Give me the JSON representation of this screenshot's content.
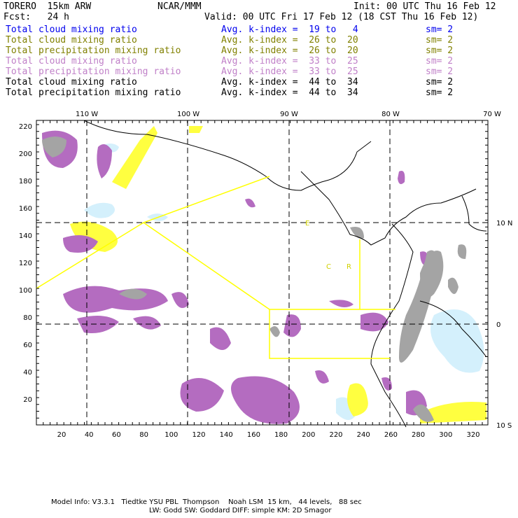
{
  "header": {
    "model": "TORERO  15km ARW",
    "org": "NCAR/MMM",
    "init": "Init: 00 UTC Thu 16 Feb 12",
    "fcst": "Fcst:   24 h",
    "valid": "Valid: 00 UTC Fri 17 Feb 12 (18 CST Thu 16 Feb 12)"
  },
  "legend": [
    {
      "field": "Total cloud mixing ratio",
      "kindex": "Avg. k-index =  19 to   4",
      "sm": "sm= 2",
      "color": "#0000ee"
    },
    {
      "field": "Total cloud mixing ratio",
      "kindex": "Avg. k-index =  26 to  20",
      "sm": "sm= 2",
      "color": "#808000"
    },
    {
      "field": "Total precipitation mixing ratio",
      "kindex": "Avg. k-index =  26 to  20",
      "sm": "sm= 2",
      "color": "#808000"
    },
    {
      "field": "Total cloud mixing ratio",
      "kindex": "Avg. k-index =  33 to  25",
      "sm": "sm= 2",
      "color": "#c080c8"
    },
    {
      "field": "Total precipitation mixing ratio",
      "kindex": "Avg. k-index =  33 to  25",
      "sm": "sm= 2",
      "color": "#c080c8"
    },
    {
      "field": "Total cloud mixing ratio",
      "kindex": "Avg. k-index =  44 to  34",
      "sm": "sm= 2",
      "color": "#000000"
    },
    {
      "field": "Total precipitation mixing ratio",
      "kindex": "Avg. k-index =  44 to  34",
      "sm": "sm= 2",
      "color": "#000000"
    }
  ],
  "map": {
    "top_lon_labels": [
      "110 W",
      "100 W",
      "90 W",
      "80 W",
      "70 W"
    ],
    "right_lat_labels": [
      "10 N",
      "0",
      "10 S"
    ],
    "y_ticks": [
      "220",
      "200",
      "180",
      "160",
      "140",
      "120",
      "100",
      "80",
      "60",
      "40",
      "20"
    ],
    "x_ticks": [
      "20",
      "40",
      "60",
      "80",
      "100",
      "120",
      "140",
      "160",
      "180",
      "200",
      "220",
      "240",
      "260",
      "280",
      "300",
      "320"
    ],
    "region_letters": [
      "E",
      "C",
      "R"
    ],
    "colors": {
      "purple": "#b46cc0",
      "gray": "#a4a4a4",
      "yellow": "#ffff40",
      "lightblue": "#d4f0fc",
      "domain": "#ffff00"
    }
  },
  "footer": {
    "line1": "Model Info: V3.3.1   Tiedtke YSU PBL  Thompson    Noah LSM  15 km,   44 levels,   88 sec",
    "line2": "LW: Godd SW: Goddard DIFF: simple KM: 2D Smagor"
  }
}
